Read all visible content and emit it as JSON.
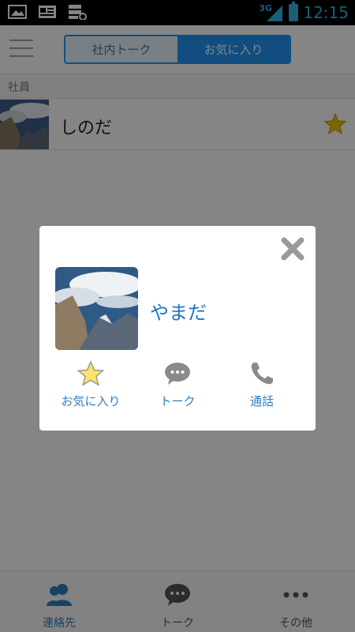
{
  "status_bar": {
    "network": "3G",
    "time": "12:15"
  },
  "header": {
    "tabs": [
      {
        "label": "社内トーク",
        "active": false
      },
      {
        "label": "お気に入り",
        "active": true
      }
    ]
  },
  "section_header": "社員",
  "list": [
    {
      "name": "しのだ",
      "favorite": true
    }
  ],
  "bottom_nav": [
    {
      "label": "連絡先",
      "icon": "contacts-icon",
      "active": true
    },
    {
      "label": "トーク",
      "icon": "chat-icon",
      "active": false
    },
    {
      "label": "その他",
      "icon": "more-icon",
      "active": false
    }
  ],
  "dialog": {
    "name": "やまだ",
    "actions": [
      {
        "label": "お気に入り",
        "icon": "star-icon"
      },
      {
        "label": "トーク",
        "icon": "chat-bubble-icon"
      },
      {
        "label": "通話",
        "icon": "phone-icon"
      }
    ]
  },
  "colors": {
    "accent": "#2196f3",
    "link": "#2e7fc0",
    "star": "#f2c200",
    "status_icons": "#33b5e5"
  }
}
